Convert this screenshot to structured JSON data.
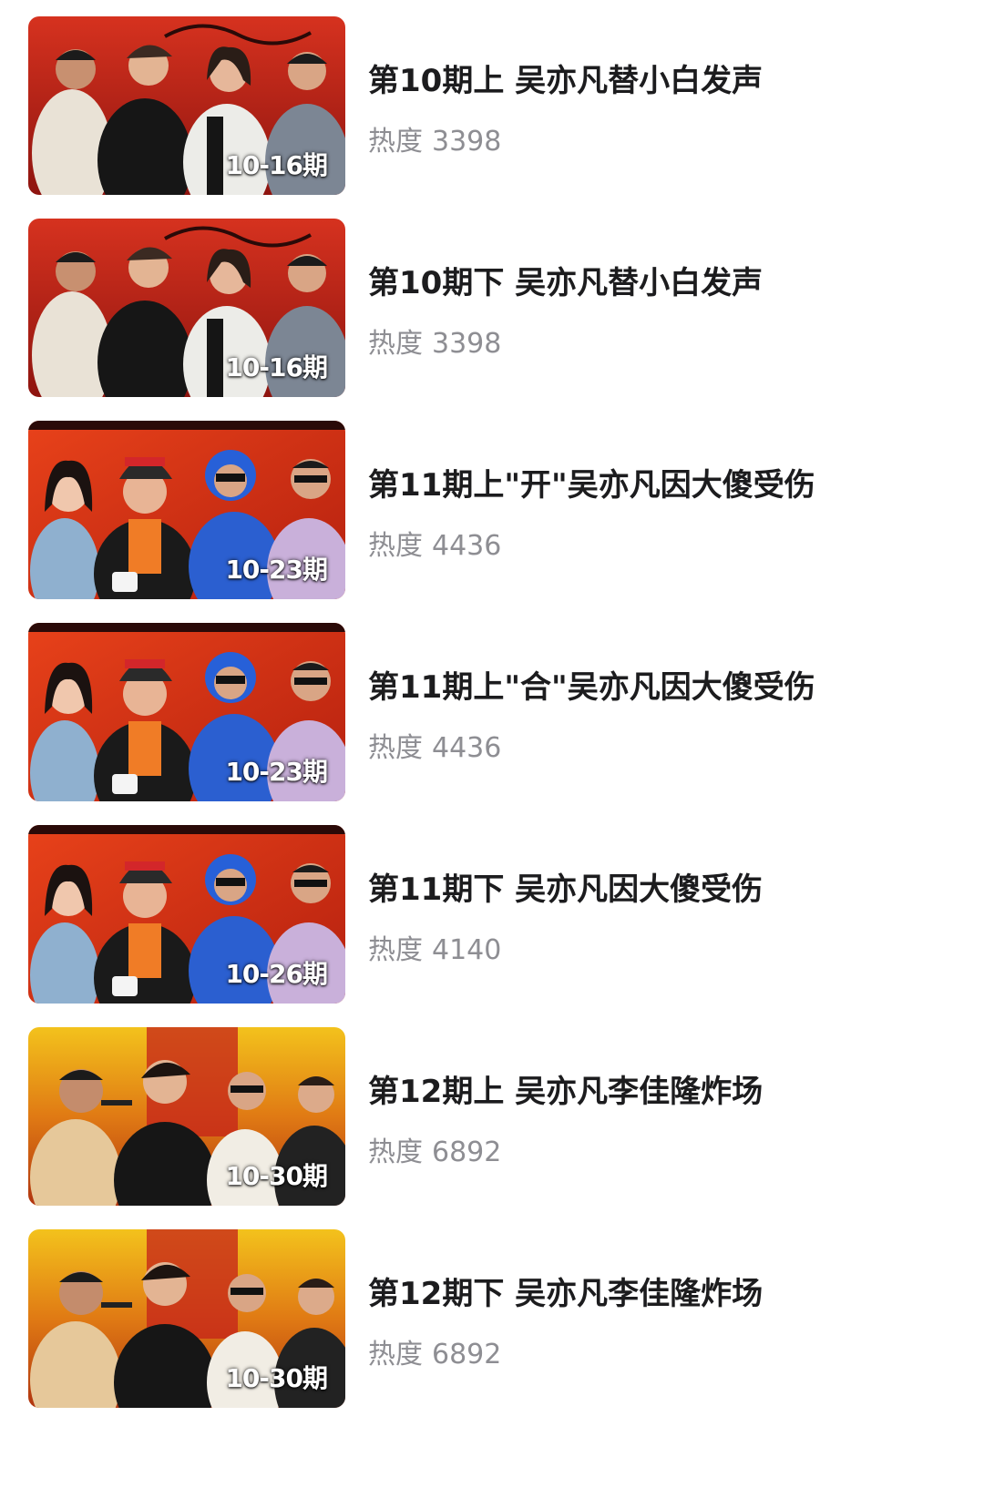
{
  "colors": {
    "title": "#1c1c1e",
    "heat": "#8e8e93",
    "red_stage": "#c8231c",
    "orange_stage": "#e0521a",
    "gold_stage": "#e0a21a"
  },
  "episodes": [
    {
      "title": "第10期上 吴亦凡替小白发声",
      "heat_label": "热度",
      "heat_value": "3398",
      "date": "10-16期",
      "theme": "red_stage"
    },
    {
      "title": "第10期下 吴亦凡替小白发声",
      "heat_label": "热度",
      "heat_value": "3398",
      "date": "10-16期",
      "theme": "red_stage"
    },
    {
      "title": "第11期上\"开\"吴亦凡因大傻受伤",
      "heat_label": "热度",
      "heat_value": "4436",
      "date": "10-23期",
      "theme": "orange_stage"
    },
    {
      "title": "第11期上\"合\"吴亦凡因大傻受伤",
      "heat_label": "热度",
      "heat_value": "4436",
      "date": "10-23期",
      "theme": "orange_stage"
    },
    {
      "title": "第11期下 吴亦凡因大傻受伤",
      "heat_label": "热度",
      "heat_value": "4140",
      "date": "10-26期",
      "theme": "orange_stage"
    },
    {
      "title": "第12期上 吴亦凡李佳隆炸场",
      "heat_label": "热度",
      "heat_value": "6892",
      "date": "10-30期",
      "theme": "gold_stage"
    },
    {
      "title": "第12期下 吴亦凡李佳隆炸场",
      "heat_label": "热度",
      "heat_value": "6892",
      "date": "10-30期",
      "theme": "gold_stage"
    }
  ]
}
